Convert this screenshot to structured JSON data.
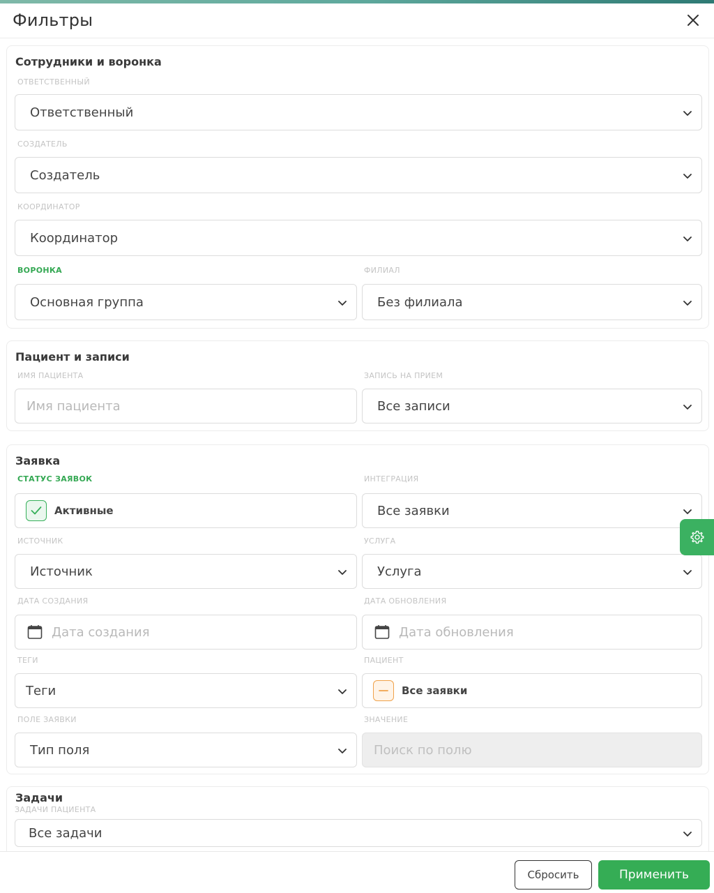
{
  "header": {
    "title": "Фильтры"
  },
  "sections": {
    "staff": {
      "title": "Сотрудники и воронка",
      "responsible": {
        "label": "ОТВЕТСТВЕННЫЙ",
        "value": "Ответственный"
      },
      "creator": {
        "label": "СОЗДАТЕЛЬ",
        "value": "Создатель"
      },
      "coordinator": {
        "label": "КООРДИНАТОР",
        "value": "Координатор"
      },
      "funnel": {
        "label": "ВОРОНКА",
        "value": "Основная группа"
      },
      "branch": {
        "label": "ФИЛИАЛ",
        "value": "Без филиала"
      }
    },
    "patient": {
      "title": "Пациент и записи",
      "name": {
        "label": "ИМЯ ПАЦИЕНТА",
        "placeholder": "Имя пациента"
      },
      "appointment": {
        "label": "ЗАПИСЬ НА ПРИЕМ",
        "value": "Все записи"
      }
    },
    "request": {
      "title": "Заявка",
      "status": {
        "label": "СТАТУС ЗАЯВОК",
        "value": "Активные"
      },
      "integration": {
        "label": "ИНТЕГРАЦИЯ",
        "value": "Все заявки"
      },
      "source": {
        "label": "ИСТОЧНИК",
        "value": "Источник"
      },
      "service": {
        "label": "УСЛУГА",
        "value": "Услуга"
      },
      "created": {
        "label": "ДАТА СОЗДАНИЯ",
        "placeholder": "Дата создания"
      },
      "updated": {
        "label": "ДАТА ОБНОВЛЕНИЯ",
        "placeholder": "Дата обновления"
      },
      "tags": {
        "label": "ТЕГИ",
        "value": "Теги"
      },
      "patient": {
        "label": "ПАЦИЕНТ",
        "value": "Все заявки"
      },
      "field": {
        "label": "ПОЛЕ ЗАЯВКИ",
        "value": "Тип поля"
      },
      "fieldValue": {
        "label": "ЗНАЧЕНИЕ",
        "placeholder": "Поиск по полю"
      }
    },
    "tasks": {
      "title": "Задачи",
      "patientTasks": {
        "label": "ЗАДАЧИ ПАЦИЕНТА",
        "value": "Все задачи"
      }
    }
  },
  "footer": {
    "reset_label": "Сбросить",
    "apply_label": "Применить"
  },
  "icons": {
    "close": "close-icon",
    "chevron": "chevron-down-icon",
    "calendar": "calendar-icon",
    "check": "check-icon",
    "minus": "minus-icon",
    "gear": "gear-icon"
  },
  "colors": {
    "accent_green": "#35ad55",
    "label_gray": "#c4c4c4",
    "partial_orange": "#f0a24a"
  }
}
